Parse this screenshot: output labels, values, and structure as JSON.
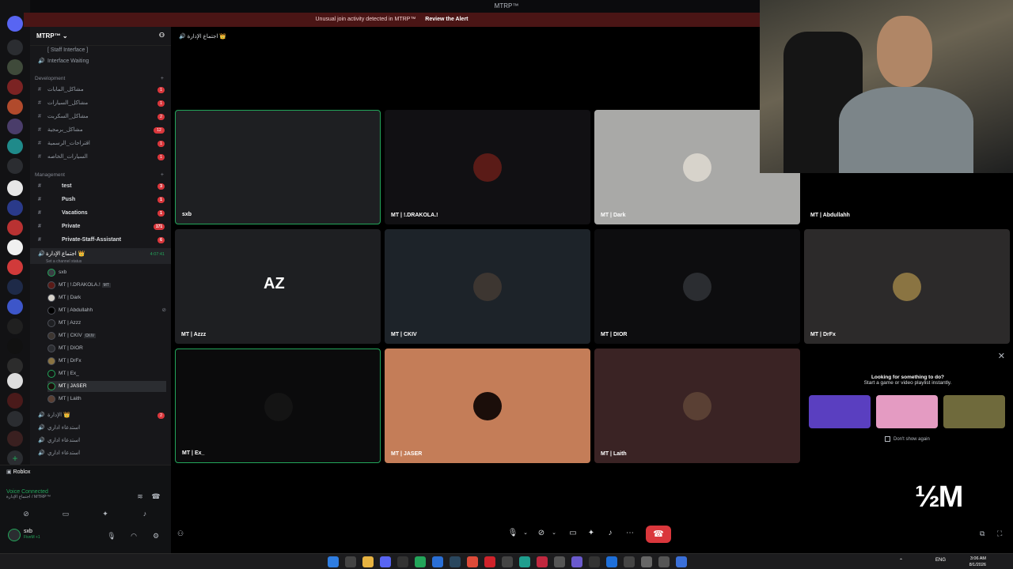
{
  "window_title": "MTRP™",
  "alert": {
    "text": "Unusual join activity detected in MTRP™",
    "action": "Review the Alert"
  },
  "server": {
    "name": "MTRP™"
  },
  "channel_header": "اجتماع الإدارة 👑",
  "sidebar": {
    "top_items": [
      "[ Staff Interface ]",
      "Interface Waiting"
    ],
    "development": {
      "label": "Development",
      "channels": [
        {
          "name": "مشاكل_المابات",
          "count": "1"
        },
        {
          "name": "مشاكل_السيارات",
          "count": "1"
        },
        {
          "name": "مشاكل_السكربت",
          "count": "2"
        },
        {
          "name": "مشاكل_برمجية",
          "count": "12"
        },
        {
          "name": "اقتراحات_الرسمية",
          "count": "1"
        },
        {
          "name": "السيارات_الخاصه",
          "count": "1"
        }
      ]
    },
    "management": {
      "label": "Management",
      "channels": [
        {
          "name": "test",
          "count": "3"
        },
        {
          "name": "Push",
          "count": "1"
        },
        {
          "name": "Vacations",
          "count": "1"
        },
        {
          "name": "Private",
          "count": "171"
        },
        {
          "name": "Private-Staff-Assistant",
          "count": "6"
        }
      ]
    },
    "voice_channel": {
      "name": "اجتماع الإدارة 👑",
      "status": "Set a channel status",
      "timer": "4:07:41"
    },
    "voice_users": [
      "sxb",
      "MT | !.DRAKOLA.!",
      "MT | Dark",
      "MT | Abdullahh",
      "MT | Azzz",
      "MT | CKIV",
      "MT | DIOR",
      "MT | DrFx",
      "MT | Ex_",
      "MT | JASER",
      "MT | Laith"
    ],
    "user_tags": {
      "drakola": "MT",
      "ckiv": "CKIV"
    },
    "after_channels": [
      {
        "name": "الإدارة 👑",
        "count": "2"
      },
      {
        "name": "استدعاء اداري"
      },
      {
        "name": "استدعاء اداري"
      },
      {
        "name": "استدعاء اداري"
      }
    ]
  },
  "panel": {
    "activity": "Roblox",
    "voice_status": "Voice Connected",
    "voice_sub": "اجتماع الإدارة / MTRP™",
    "user": "sxb",
    "user_sub": "FiveM +1"
  },
  "tiles": [
    {
      "name": "sxb",
      "bg": "#1e1f22",
      "pic": "",
      "speaking": true
    },
    {
      "name": "MT | !.DRAKOLA.!",
      "bg": "#111013",
      "pic": "#5a1b17"
    },
    {
      "name": "MT | Dark",
      "bg": "#a9a9a7",
      "pic": "#d7d3cb"
    },
    {
      "name": "MT | Abdullahh",
      "bg": "#000000",
      "pic": ""
    },
    {
      "name": "MT | Azzz",
      "bg": "#1e1f22",
      "pic": "",
      "logo": "AZ"
    },
    {
      "name": "MT | CKIV",
      "bg": "#1d2329",
      "pic": "#3d3631"
    },
    {
      "name": "MT | DIOR",
      "bg": "#0d0d0f",
      "pic": "#2b2d31"
    },
    {
      "name": "MT | DrFx",
      "bg": "#2c2a2a",
      "pic": "#8a7442"
    },
    {
      "name": "MT | Ex_",
      "bg": "#0b0b0c",
      "pic": "#141414"
    },
    {
      "name": "MT | JASER",
      "bg": "#c47d58",
      "pic": "#1b0e0a"
    },
    {
      "name": "MT | Laith",
      "bg": "#3a2324",
      "pic": "#5a4034"
    }
  ],
  "promo": {
    "title": "Looking for something to do?",
    "sub": "Start a game or video playlist instantly.",
    "checkbox": "Don't show again",
    "thumbs": [
      "#5a3fc0",
      "#e49bc2",
      "#6f6a3c"
    ]
  },
  "watermark": "½M",
  "taskbar": {
    "lang": "ENG",
    "time": "3:06 AM",
    "date": "8/1/2026"
  },
  "colors": {
    "accent_green": "#23a55a",
    "danger": "#da373c",
    "alert_bg": "#4a1515"
  }
}
